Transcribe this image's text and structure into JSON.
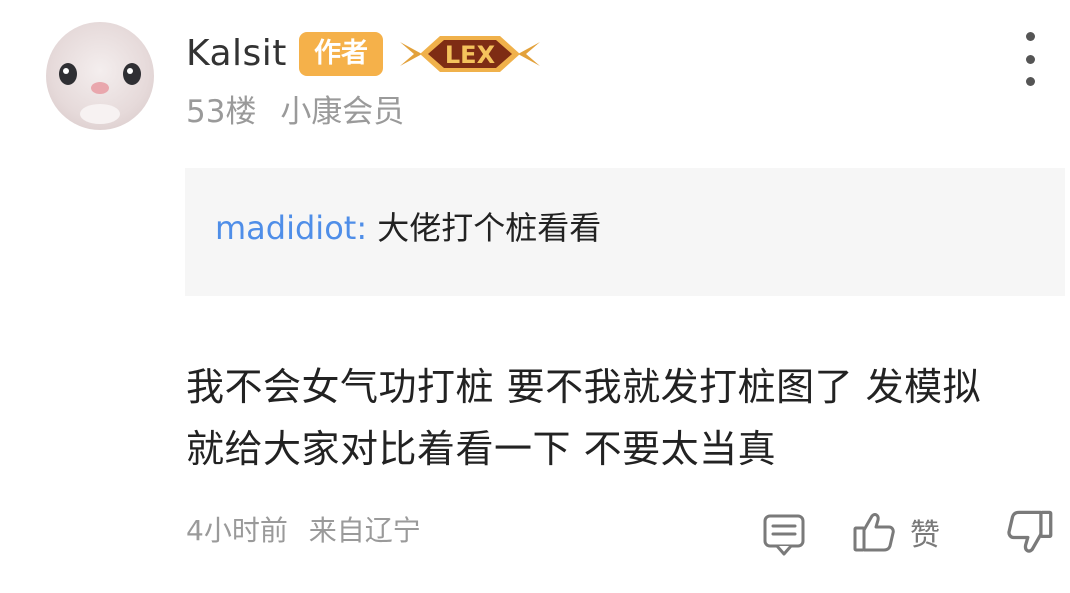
{
  "user": {
    "name": "Kalsit",
    "author_badge": "作者",
    "level_badge": "LEX",
    "floor": "53楼",
    "membership": "小康会员"
  },
  "quote": {
    "user": "madidiot:",
    "text": "大佬打个桩看看"
  },
  "comment": {
    "lines": [
      "我不会女气功打桩 要不我就发打桩图了 发模拟",
      "就给大家对比着看一下 不要太当真"
    ]
  },
  "footer": {
    "time": "4小时前",
    "location": "来自辽宁",
    "like_label": "赞"
  },
  "icons": {
    "avatar": "bunny-avatar",
    "level": "level-badge-icon",
    "more": "more-vertical-icon",
    "reply": "reply-comment-icon",
    "like": "thumbs-up-icon",
    "dislike": "thumbs-down-icon"
  },
  "colors": {
    "author_badge": "#f5b14a",
    "quote_user": "#4f8ee8",
    "quote_bg": "#f6f6f6",
    "meta_text": "#9a9a9a"
  }
}
